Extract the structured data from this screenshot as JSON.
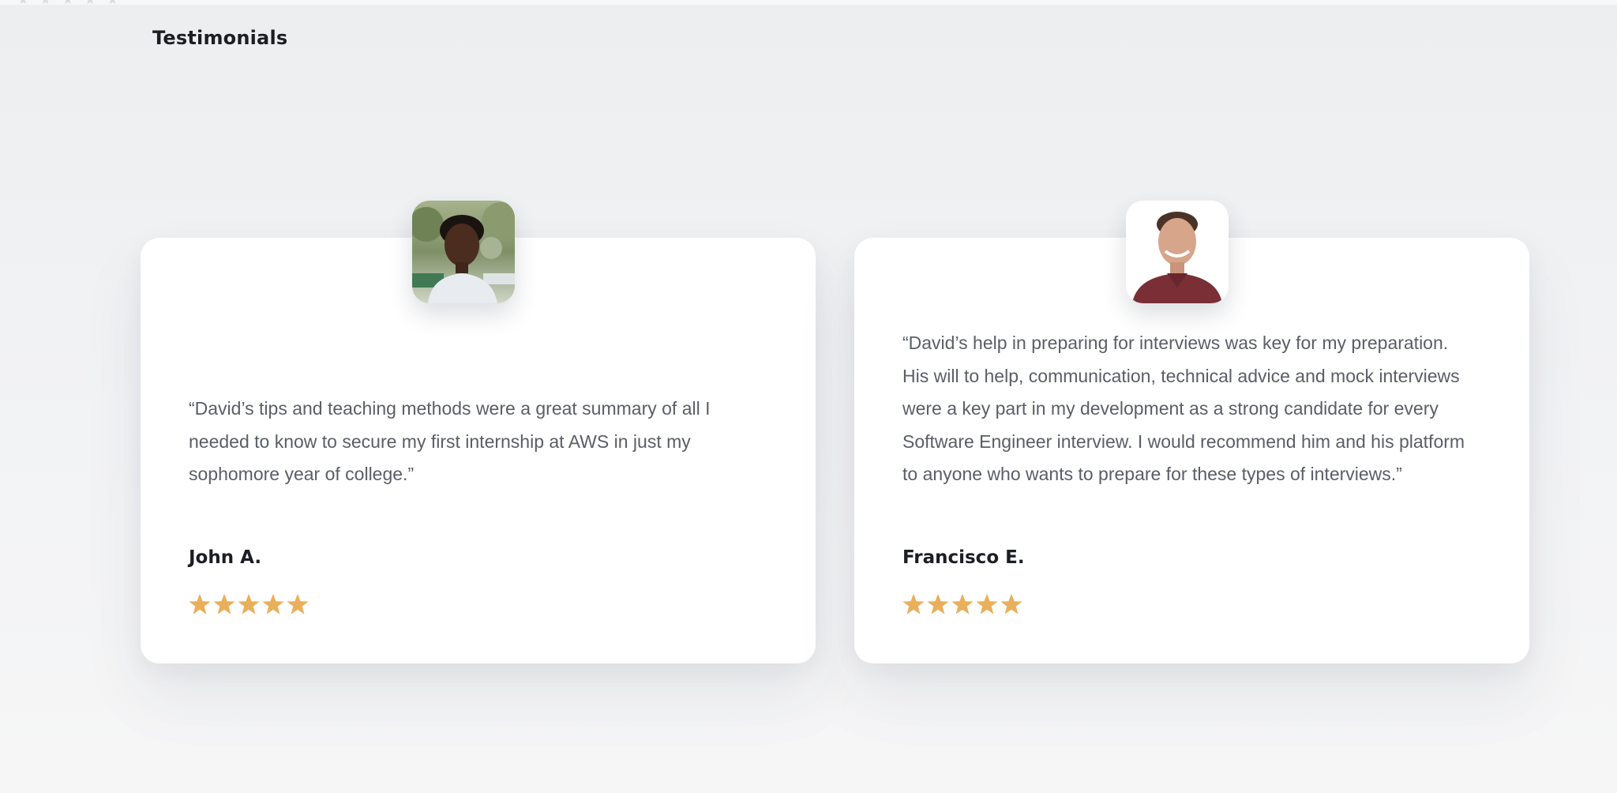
{
  "section": {
    "title": "Testimonials"
  },
  "colors": {
    "star": "#e9af5a",
    "card_bg": "#ffffff",
    "heading": "#1b1e22",
    "body_text": "#5a5e66"
  },
  "testimonials": [
    {
      "quote": "“David’s tips and teaching methods were a great summary of all I needed to know to secure my first internship at AWS in just my sophomore year of college.”",
      "name": "John A.",
      "rating": 5,
      "rating_max": 5,
      "avatar_icon": "person-photo"
    },
    {
      "quote": "“David’s help in preparing for interviews was key for my preparation. His will to help, communication, technical advice and mock interviews were a key part in my development as a strong candidate for every Software Engineer interview. I would recommend him and his platform to anyone who wants to prepare for these types of interviews.”",
      "name": "Francisco E.",
      "rating": 5,
      "rating_max": 5,
      "avatar_icon": "person-photo"
    }
  ]
}
